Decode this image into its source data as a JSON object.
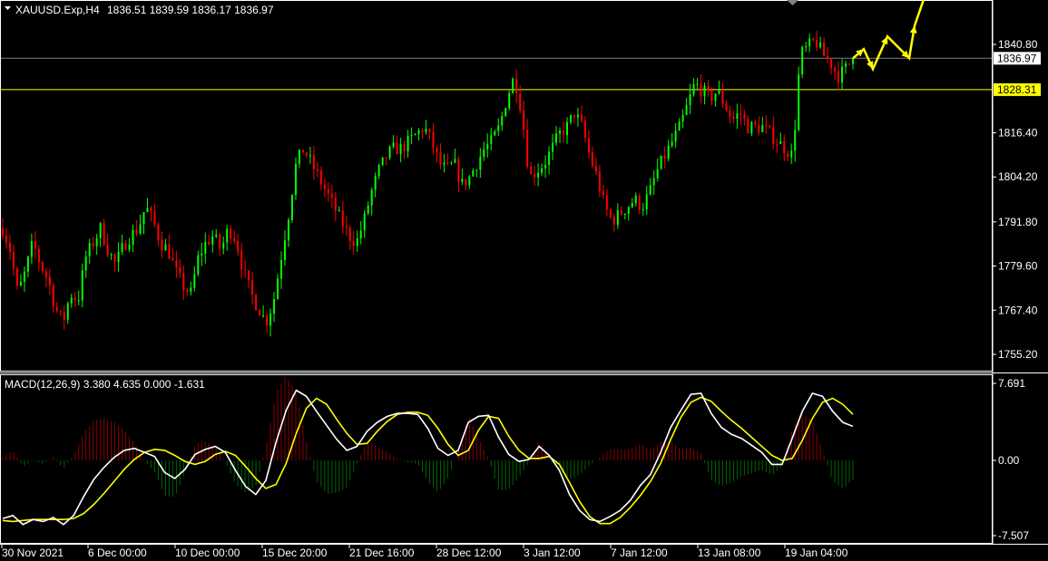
{
  "window": {
    "symbol": "XAUUSD.Exp,H4",
    "ohlc": "1836.51 1839.59 1836.17 1836.97"
  },
  "price_axis": {
    "ticks": [
      "1840.80",
      "1828.31",
      "1816.40",
      "1804.20",
      "1791.80",
      "1779.60",
      "1767.40",
      "1755.20"
    ],
    "current_price_label": "1836.97",
    "level_line_label": "1828.31"
  },
  "macd_panel": {
    "label": "MACD(12,26,9) 3.380 4.635 0.000 -1.631",
    "ticks": [
      "7.691",
      "0.00",
      "-7.507"
    ]
  },
  "time_axis": {
    "labels": [
      "30 Nov 2021",
      "6 Dec 00:00",
      "10 Dec 00:00",
      "15 Dec 20:00",
      "21 Dec 16:00",
      "28 Dec 12:00",
      "3 Jan 12:00",
      "7 Jan 12:00",
      "13 Jan 08:00",
      "19 Jan 04:00"
    ]
  },
  "colors": {
    "bull": "#00ff00",
    "bear": "#ff0000",
    "current_line": "#808080",
    "level_line": "#ffff00",
    "signal": "#ffff00",
    "macd_main": "#ffffff",
    "hist_pos": "#8b0000",
    "hist_neg": "#006400",
    "forecast_arrow": "#ffff00"
  },
  "chart_data": [
    {
      "type": "candlestick",
      "title": "XAUUSD.Exp,H4",
      "ylim": [
        1751,
        1848
      ],
      "current_price": 1836.97,
      "level_line": 1828.31,
      "price_path": [
        1790,
        1784,
        1772,
        1778,
        1786,
        1780,
        1776,
        1768,
        1764,
        1772,
        1770,
        1782,
        1786,
        1790,
        1784,
        1780,
        1785,
        1788,
        1790,
        1796,
        1792,
        1786,
        1784,
        1778,
        1774,
        1772,
        1782,
        1786,
        1788,
        1784,
        1790,
        1787,
        1778,
        1772,
        1768,
        1764,
        1770,
        1782,
        1794,
        1808,
        1812,
        1808,
        1804,
        1800,
        1796,
        1792,
        1788,
        1786,
        1792,
        1800,
        1806,
        1810,
        1812,
        1812,
        1814,
        1816,
        1818,
        1814,
        1808,
        1806,
        1808,
        1802,
        1804,
        1808,
        1812,
        1814,
        1818,
        1826,
        1832,
        1822,
        1804,
        1806,
        1808,
        1812,
        1816,
        1818,
        1822,
        1818,
        1810,
        1804,
        1796,
        1792,
        1794,
        1796,
        1798,
        1796,
        1800,
        1806,
        1810,
        1814,
        1818,
        1824,
        1830,
        1828,
        1826,
        1828,
        1824,
        1820,
        1822,
        1818,
        1818,
        1818,
        1816,
        1814,
        1812,
        1810,
        1838,
        1840,
        1842,
        1838,
        1836,
        1832,
        1834,
        1836.97
      ],
      "forecast": {
        "type": "line",
        "x": [
          0,
          1,
          2,
          3,
          4,
          5,
          6
        ],
        "y": [
          1836.97,
          1839.5,
          1834,
          1843,
          1837,
          1846,
          1859
        ]
      }
    },
    {
      "type": "line",
      "title": "MACD(12,26,9)",
      "ylim": [
        -7.507,
        7.691
      ],
      "main_value": 3.38,
      "signal_value": 4.635,
      "series": [
        {
          "name": "main",
          "values": [
            -5.8,
            -5.5,
            -6.4,
            -5.9,
            -6.1,
            -5.7,
            -6.4,
            -5.5,
            -3.6,
            -1.9,
            -0.7,
            0.3,
            1.0,
            1.2,
            0.8,
            0.4,
            -1.2,
            -1.8,
            -0.9,
            0.6,
            1.1,
            1.4,
            0.8,
            -1.0,
            -2.6,
            -3.4,
            -2.0,
            1.8,
            5.0,
            7.0,
            6.4,
            4.9,
            3.5,
            2.1,
            1.0,
            1.4,
            2.9,
            3.8,
            4.4,
            4.7,
            4.7,
            4.6,
            3.2,
            1.2,
            0.5,
            1.0,
            3.8,
            4.4,
            4.5,
            2.3,
            0.6,
            -0.1,
            0.1,
            1.4,
            0.5,
            -1.0,
            -3.4,
            -5.0,
            -5.9,
            -6.1,
            -5.6,
            -5.0,
            -4.0,
            -2.5,
            -1.4,
            0.8,
            3.3,
            5.0,
            6.6,
            6.7,
            4.7,
            3.3,
            2.6,
            2.2,
            1.5,
            0.8,
            -0.4,
            -0.4,
            2.2,
            4.9,
            6.7,
            6.4,
            4.9,
            3.8,
            3.4
          ]
        },
        {
          "name": "signal",
          "values": [
            -6.0,
            -6.1,
            -6.0,
            -5.9,
            -5.9,
            -5.9,
            -5.9,
            -5.8,
            -5.3,
            -4.4,
            -3.3,
            -2.1,
            -0.9,
            0.1,
            0.8,
            1.1,
            1.0,
            0.5,
            -0.1,
            -0.4,
            -0.1,
            0.6,
            0.9,
            0.5,
            -0.6,
            -1.8,
            -2.8,
            -2.4,
            -0.3,
            2.7,
            5.2,
            6.2,
            5.6,
            4.1,
            2.7,
            1.6,
            1.7,
            2.9,
            3.9,
            4.6,
            4.8,
            4.8,
            4.5,
            3.2,
            1.6,
            0.5,
            1.0,
            3.0,
            4.4,
            4.2,
            2.4,
            1.0,
            0.2,
            0.2,
            0.4,
            -0.4,
            -2.2,
            -4.1,
            -5.6,
            -6.3,
            -6.3,
            -5.7,
            -4.7,
            -3.5,
            -2.1,
            -0.3,
            2.1,
            4.3,
            5.8,
            6.3,
            5.9,
            4.9,
            4.0,
            3.2,
            2.3,
            1.4,
            0.5,
            0.0,
            0.2,
            2.0,
            4.2,
            5.8,
            6.2,
            5.6,
            4.6
          ]
        }
      ],
      "histogram_bars": 236
    }
  ]
}
